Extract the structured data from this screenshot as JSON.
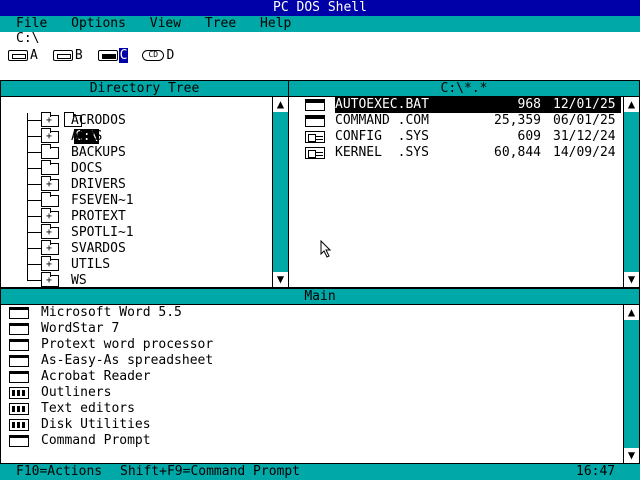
{
  "title": "PC DOS Shell",
  "menu": [
    "File",
    "Options",
    "View",
    "Tree",
    "Help"
  ],
  "current_path": "C:\\",
  "drives": [
    {
      "label": "A",
      "icon": "floppy-drive-icon",
      "selected": false
    },
    {
      "label": "B",
      "icon": "floppy-drive-icon",
      "selected": false
    },
    {
      "label": "C",
      "icon": "hard-drive-icon",
      "selected": true
    },
    {
      "label": "D",
      "icon": "cd-drive-icon",
      "selected": false
    }
  ],
  "directory_tree": {
    "header": "Directory Tree",
    "root": "C:\\",
    "folders": [
      {
        "name": "ACRODOS",
        "expandable": true
      },
      {
        "name": "APPS",
        "expandable": true
      },
      {
        "name": "BACKUPS",
        "expandable": false
      },
      {
        "name": "DOCS",
        "expandable": false
      },
      {
        "name": "DRIVERS",
        "expandable": true
      },
      {
        "name": "FSEVEN~1",
        "expandable": false
      },
      {
        "name": "PROTEXT",
        "expandable": true
      },
      {
        "name": "SPOTLI~1",
        "expandable": true
      },
      {
        "name": "SVARDOS",
        "expandable": true
      },
      {
        "name": "UTILS",
        "expandable": true
      },
      {
        "name": "WS",
        "expandable": true
      }
    ]
  },
  "file_list": {
    "header": "C:\\*.*",
    "files": [
      {
        "name": "AUTOEXEC.BAT",
        "size": "968",
        "date": "12/01/25",
        "type": "exe",
        "selected": true
      },
      {
        "name": "COMMAND .COM",
        "size": "25,359",
        "date": "06/01/25",
        "type": "exe",
        "selected": false
      },
      {
        "name": "CONFIG  .SYS",
        "size": "609",
        "date": "31/12/24",
        "type": "sys",
        "selected": false
      },
      {
        "name": "KERNEL  .SYS",
        "size": "60,844",
        "date": "14/09/24",
        "type": "sys",
        "selected": false
      }
    ]
  },
  "main_group": {
    "header": "Main",
    "items": [
      {
        "label": "Microsoft Word 5.5",
        "kind": "program"
      },
      {
        "label": "WordStar 7",
        "kind": "program"
      },
      {
        "label": "Protext word processor",
        "kind": "program"
      },
      {
        "label": "As-Easy-As spreadsheet",
        "kind": "program"
      },
      {
        "label": "Acrobat Reader",
        "kind": "program"
      },
      {
        "label": "Outliners",
        "kind": "group"
      },
      {
        "label": "Text editors",
        "kind": "group"
      },
      {
        "label": "Disk Utilities",
        "kind": "group"
      },
      {
        "label": "Command Prompt",
        "kind": "program"
      }
    ]
  },
  "status": {
    "hint1": "F10=Actions",
    "hint2": "Shift+F9=Command Prompt",
    "clock": "16:47"
  },
  "colors": {
    "title_bg": "#0000a8",
    "menu_bg": "#00a8a8",
    "selection": "#000000"
  }
}
